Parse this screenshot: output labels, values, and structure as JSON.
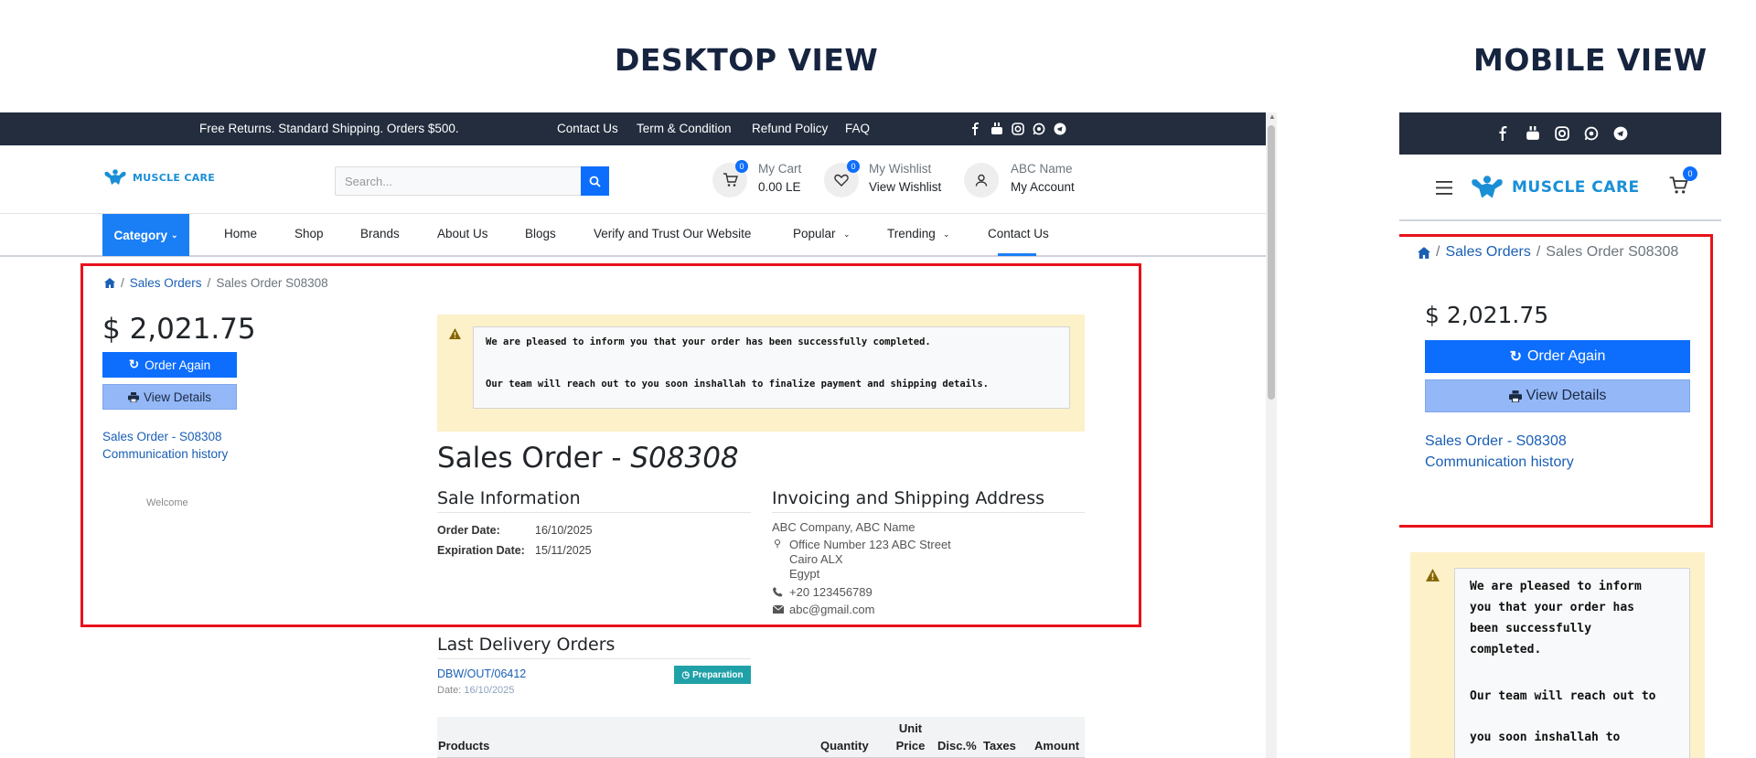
{
  "labels": {
    "desktop_view": "DESKTOP VIEW",
    "mobile_view": "MOBILE VIEW"
  },
  "topbar": {
    "promo": "Free Returns. Standard Shipping. Orders $500.",
    "links": [
      "Contact Us",
      "Term & Condition",
      "Refund Policy",
      "FAQ"
    ],
    "social_icons": [
      "facebook-icon",
      "youtube-icon",
      "instagram-icon",
      "whatsapp-icon",
      "telegram-icon"
    ]
  },
  "brand": {
    "name": "MUSCLE CARE",
    "color": "#1a8fd6"
  },
  "search": {
    "placeholder": "Search..."
  },
  "cart": {
    "label": "My Cart",
    "value": "0.00 LE",
    "count": "0"
  },
  "wishlist": {
    "label": "My Wishlist",
    "value": "View Wishlist",
    "count": "0"
  },
  "account": {
    "label": "ABC Name",
    "value": "My Account"
  },
  "nav": {
    "category": "Category",
    "items": [
      "Home",
      "Shop",
      "Brands",
      "About Us",
      "Blogs",
      "Verify and Trust Our Website",
      "Popular",
      "Trending",
      "Contact Us"
    ]
  },
  "breadcrumb": {
    "level1": "Sales Orders",
    "level2": "Sales Order S08308"
  },
  "order": {
    "total": "$ 2,021.75",
    "order_again": "Order Again",
    "view_details": "View Details",
    "link1": "Sales Order - S08308",
    "link2": "Communication history",
    "welcome": "Welcome",
    "title_prefix": "Sales Order - ",
    "title_number": "S08308",
    "alert_line1": "We are pleased to inform you that your order has been successfully completed.",
    "alert_line2": "Our team will reach out to you soon inshallah to finalize payment and shipping details."
  },
  "sale_info": {
    "heading": "Sale Information",
    "order_date_label": "Order Date:",
    "order_date": "16/10/2025",
    "expiration_label": "Expiration Date:",
    "expiration_date": "15/11/2025"
  },
  "address": {
    "heading": "Invoicing and Shipping Address",
    "name": "ABC Company, ABC Name",
    "line1": "Office Number 123 ABC Street",
    "line2": "Cairo ALX",
    "line3": "Egypt",
    "phone": "+20 123456789",
    "email": "abc@gmail.com"
  },
  "delivery": {
    "heading": "Last Delivery Orders",
    "ref": "DBW/OUT/06412",
    "date_label": "Date:",
    "date": "16/10/2025",
    "status": "Preparation"
  },
  "table": {
    "headers": [
      "Products",
      "Quantity",
      "Unit Price",
      "Disc.%",
      "Taxes",
      "Amount"
    ]
  },
  "mobile": {
    "alert_lines": [
      "We are pleased to inform",
      "you that your order has",
      "been successfully",
      "completed."
    ],
    "alert_lines2": [
      "Our team will reach out to",
      "you soon inshallah to"
    ]
  },
  "colors": {
    "accent": "#0d6efd",
    "topbar": "#232d3e",
    "highlight": "#e8121b",
    "alert": "#fdf1c9"
  }
}
